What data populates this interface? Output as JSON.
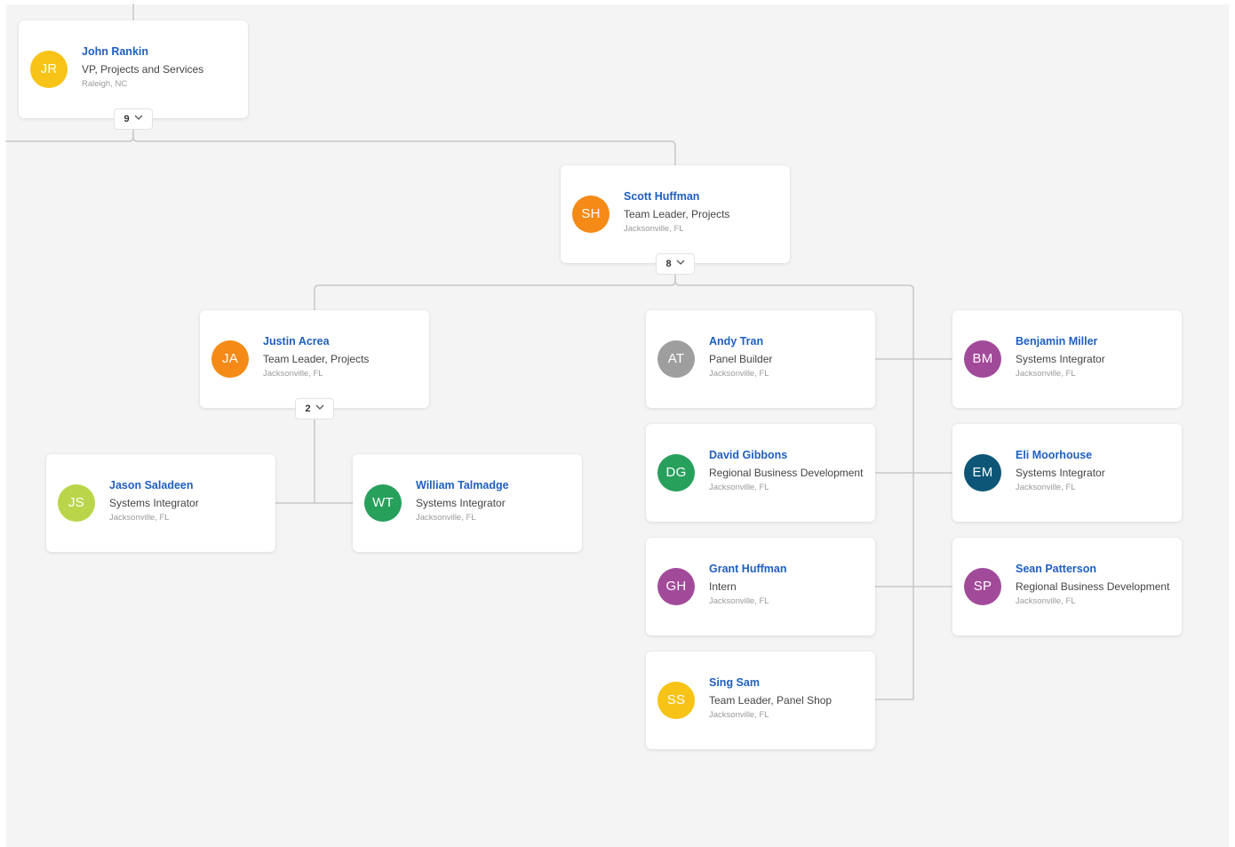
{
  "colors": {
    "name_link": "#1f5fc2",
    "connector": "#c8c8c8",
    "canvas_bg": "#f4f4f4"
  },
  "nodes": {
    "john_rankin": {
      "name": "John Rankin",
      "title": "VP, Projects and Services",
      "location": "Raleigh, NC",
      "initials": "JR",
      "avatar_color": "#f7c316"
    },
    "scott_huffman": {
      "name": "Scott Huffman",
      "title": "Team Leader, Projects",
      "location": "Jacksonville, FL",
      "initials": "SH",
      "avatar_color": "#f58a16"
    },
    "justin_acrea": {
      "name": "Justin Acrea",
      "title": "Team Leader, Projects",
      "location": "Jacksonville, FL",
      "initials": "JA",
      "avatar_color": "#f58a16"
    },
    "jason_saladeen": {
      "name": "Jason Saladeen",
      "title": "Systems Integrator",
      "location": "Jacksonville, FL",
      "initials": "JS",
      "avatar_color": "#b9d64a"
    },
    "william_talmadge": {
      "name": "William Talmadge",
      "title": "Systems Integrator",
      "location": "Jacksonville, FL",
      "initials": "WT",
      "avatar_color": "#27a05c"
    },
    "andy_tran": {
      "name": "Andy Tran",
      "title": "Panel Builder",
      "location": "Jacksonville, FL",
      "initials": "AT",
      "avatar_color": "#9e9e9e"
    },
    "benjamin_miller": {
      "name": "Benjamin Miller",
      "title": "Systems Integrator",
      "location": "Jacksonville, FL",
      "initials": "BM",
      "avatar_color": "#a24a9a"
    },
    "david_gibbons": {
      "name": "David Gibbons",
      "title": "Regional Business Development",
      "location": "Jacksonville, FL",
      "initials": "DG",
      "avatar_color": "#27a05c"
    },
    "eli_moorhouse": {
      "name": "Eli Moorhouse",
      "title": "Systems Integrator",
      "location": "Jacksonville, FL",
      "initials": "EM",
      "avatar_color": "#0d5677"
    },
    "grant_huffman": {
      "name": "Grant Huffman",
      "title": "Intern",
      "location": "Jacksonville, FL",
      "initials": "GH",
      "avatar_color": "#a24a9a"
    },
    "sean_patterson": {
      "name": "Sean Patterson",
      "title": "Regional Business Development",
      "location": "Jacksonville, FL",
      "initials": "SP",
      "avatar_color": "#a24a9a"
    },
    "sing_sam": {
      "name": "Sing Sam",
      "title": "Team Leader, Panel Shop",
      "location": "Jacksonville, FL",
      "initials": "SS",
      "avatar_color": "#f7c316"
    }
  },
  "toggles": {
    "john_rankin": {
      "count": "9",
      "icon": "chevron-down-icon"
    },
    "scott_huffman": {
      "count": "8",
      "icon": "chevron-down-icon"
    },
    "justin_acrea": {
      "count": "2",
      "icon": "chevron-down-icon"
    }
  }
}
